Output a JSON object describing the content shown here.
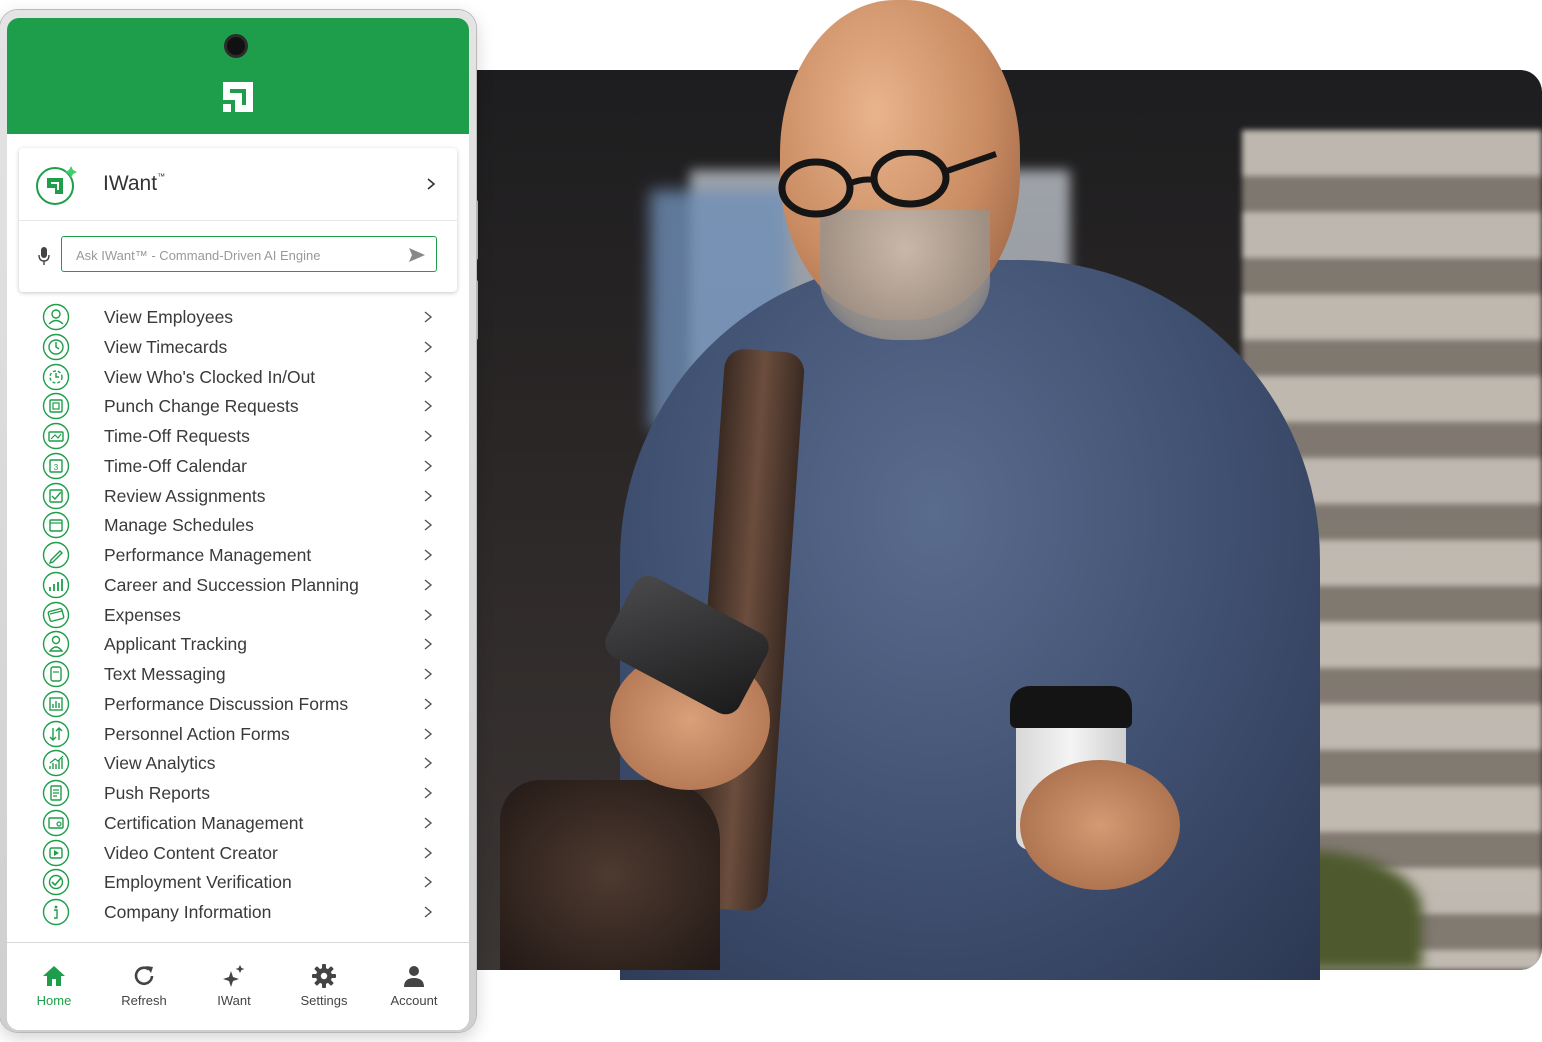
{
  "colors": {
    "brand": "#1e9e4a",
    "icon_stroke": "#1e9e4a",
    "text": "#3a3a3a"
  },
  "iwant": {
    "title": "IWant",
    "trademark": "™",
    "placeholder": "Ask IWant™ - Command-Driven AI Engine"
  },
  "menu": [
    {
      "label": "View Employees",
      "icon": "person-icon"
    },
    {
      "label": "View Timecards",
      "icon": "clock-icon"
    },
    {
      "label": "View Who's Clocked In/Out",
      "icon": "clock-arrows-icon"
    },
    {
      "label": "Punch Change Requests",
      "icon": "punch-card-icon"
    },
    {
      "label": "Time-Off Requests",
      "icon": "beach-icon"
    },
    {
      "label": "Time-Off Calendar",
      "icon": "calendar-icon"
    },
    {
      "label": "Review Assignments",
      "icon": "checklist-icon"
    },
    {
      "label": "Manage Schedules",
      "icon": "schedule-icon"
    },
    {
      "label": "Performance Management",
      "icon": "pen-icon"
    },
    {
      "label": "Career and Succession Planning",
      "icon": "growth-chart-icon"
    },
    {
      "label": "Expenses",
      "icon": "credit-card-icon"
    },
    {
      "label": "Applicant Tracking",
      "icon": "applicant-icon"
    },
    {
      "label": "Text Messaging",
      "icon": "message-icon"
    },
    {
      "label": "Performance Discussion Forms",
      "icon": "bar-chart-icon"
    },
    {
      "label": "Personnel Action Forms",
      "icon": "arrows-icon"
    },
    {
      "label": "View Analytics",
      "icon": "analytics-icon"
    },
    {
      "label": "Push Reports",
      "icon": "report-icon"
    },
    {
      "label": "Certification Management",
      "icon": "certificate-icon"
    },
    {
      "label": "Video Content Creator",
      "icon": "video-icon"
    },
    {
      "label": "Employment Verification",
      "icon": "verified-icon"
    },
    {
      "label": "Company Information",
      "icon": "info-icon"
    }
  ],
  "nav": {
    "home": "Home",
    "refresh": "Refresh",
    "iwant": "IWant",
    "settings": "Settings",
    "account": "Account"
  }
}
